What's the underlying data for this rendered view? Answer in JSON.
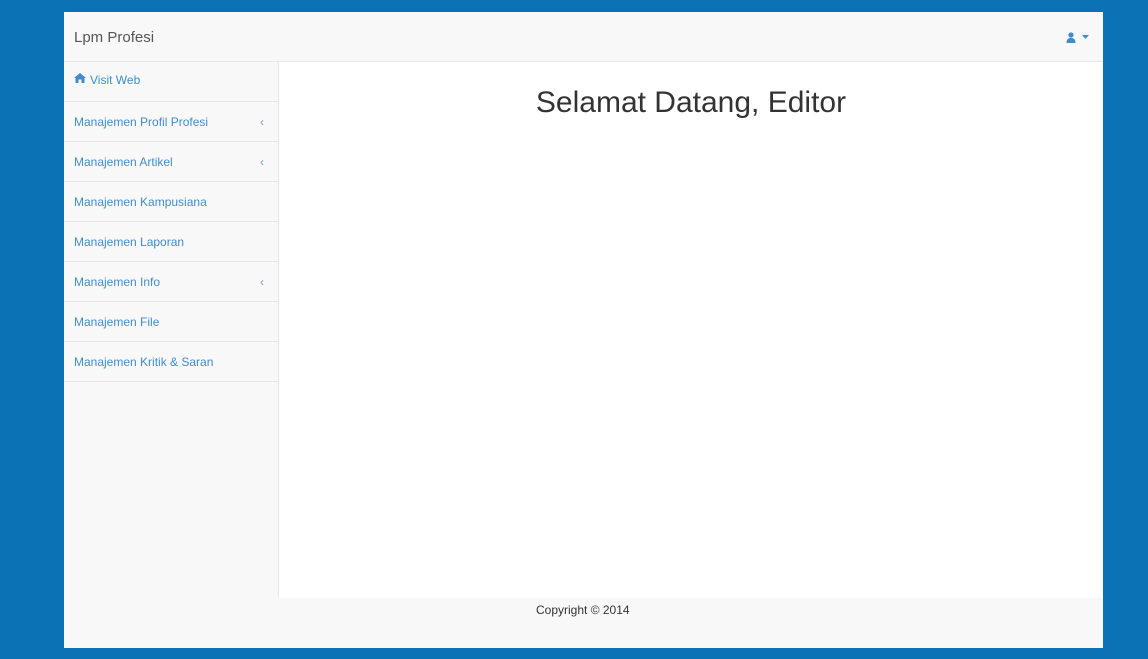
{
  "navbar": {
    "brand": "Lpm Profesi",
    "user_icon": "user-icon",
    "caret_icon": "caret-down-icon"
  },
  "sidebar": {
    "items": [
      {
        "label": "Visit Web",
        "icon": "home-icon",
        "has_submenu": false
      },
      {
        "label": "Manajemen Profil Profesi",
        "has_submenu": true
      },
      {
        "label": "Manajemen Artikel",
        "has_submenu": true
      },
      {
        "label": "Manajemen Kampusiana",
        "has_submenu": false
      },
      {
        "label": "Manajemen Laporan",
        "has_submenu": false
      },
      {
        "label": "Manajemen Info",
        "has_submenu": true
      },
      {
        "label": "Manajemen File",
        "has_submenu": false
      },
      {
        "label": "Manajemen Kritik & Saran",
        "has_submenu": false
      }
    ],
    "chevron_glyph": "‹"
  },
  "main": {
    "title": "Selamat Datang, Editor"
  },
  "footer": {
    "copyright": "Copyright © 2014"
  },
  "colors": {
    "background": "#0b72b5",
    "link": "#428bca",
    "panel": "#f8f8f8",
    "content": "#ffffff"
  }
}
